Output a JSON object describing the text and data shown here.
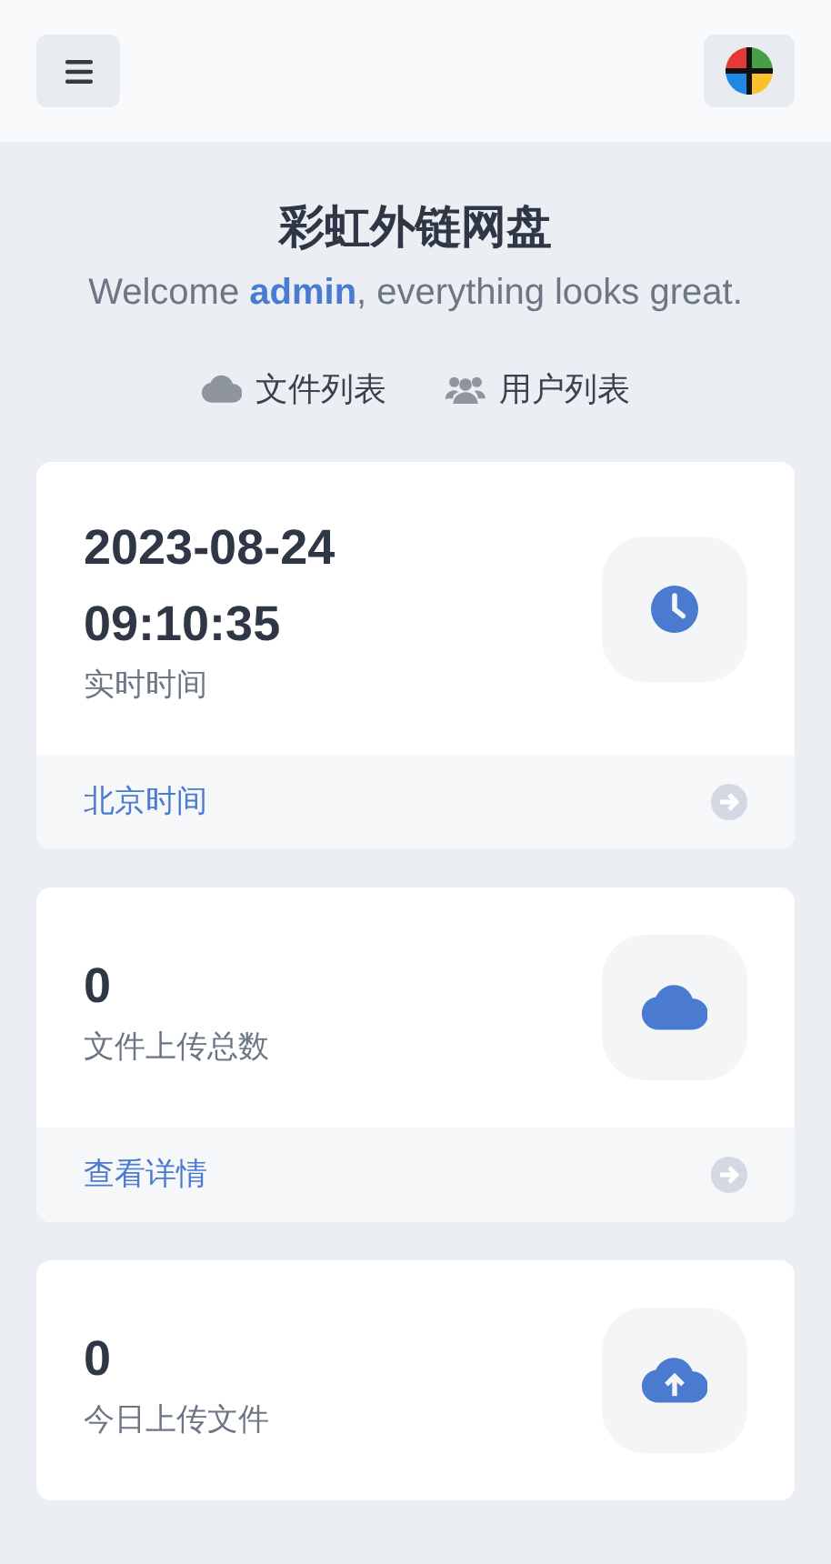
{
  "title": "彩虹外链网盘",
  "welcome": "Welcome **admin**, everything looks great.",
  "nav_links": [
    {
      "label": "文件列表"
    },
    {
      "label": "用户列表"
    }
  ],
  "cards": [
    {
      "value_lines": [
        "2023-08-24",
        "09:10:35"
      ],
      "label": "实时时间",
      "footer": "北京时间"
    },
    {
      "value_lines": [
        "0"
      ],
      "label": "文件上传总数",
      "footer": "查看详情"
    },
    {
      "value_lines": [
        "0"
      ],
      "label": "今日上传文件"
    }
  ]
}
